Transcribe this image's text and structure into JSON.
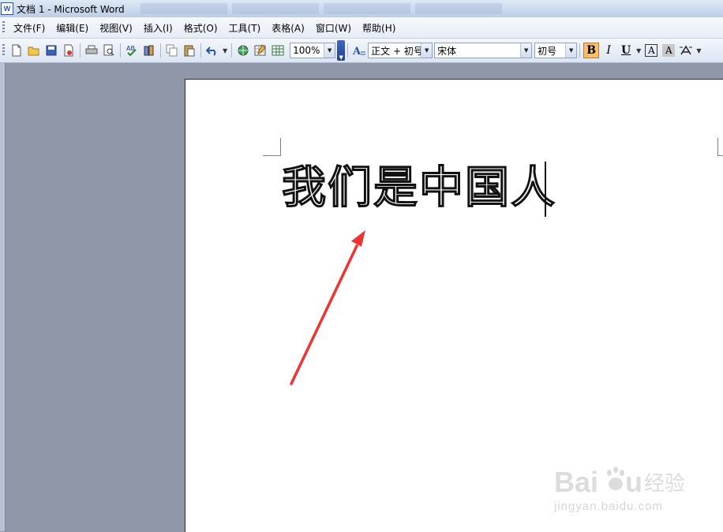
{
  "window": {
    "title": "文档 1 - Microsoft Word",
    "app_icon_letter": "W"
  },
  "menu": {
    "items": [
      "文件(F)",
      "编辑(E)",
      "视图(V)",
      "插入(I)",
      "格式(O)",
      "工具(T)",
      "表格(A)",
      "窗口(W)",
      "帮助(H)"
    ]
  },
  "toolbar": {
    "zoom_value": "100%",
    "style_value": "正文 + 初号",
    "font_value": "宋体",
    "size_value": "初号",
    "bold_label": "B",
    "italic_label": "I",
    "underline_label": "U",
    "char_border_label": "A",
    "char_shading_label": "A"
  },
  "document": {
    "text": "我们是中国人"
  },
  "watermark": {
    "logo_text": "Baidu 经验",
    "url_text": "jingyan.baidu.com"
  },
  "colors": {
    "arrow": "#ee3333",
    "accent_bold": "#f7c070",
    "workspace": "#8f97a8"
  }
}
